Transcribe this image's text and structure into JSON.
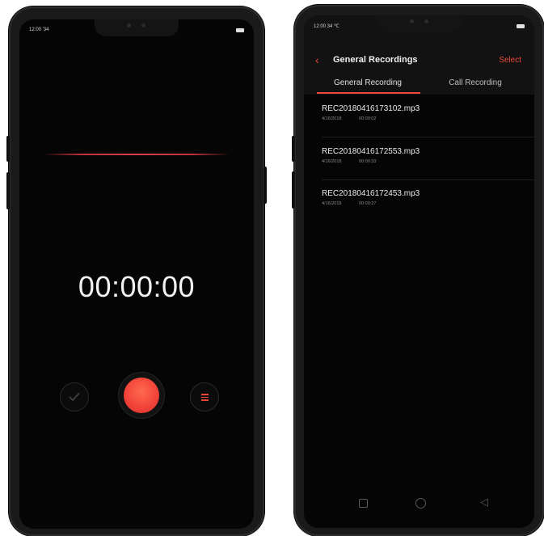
{
  "recorder_screen": {
    "status_time": "12:00 '34",
    "timer": "00:00:00"
  },
  "recordings_screen": {
    "status_time": "12:00 34 ℃",
    "title": "General Recordings",
    "select_label": "Select",
    "tabs": [
      {
        "label": "General Recording",
        "active": true
      },
      {
        "label": "Call Recording",
        "active": false
      }
    ],
    "recordings": [
      {
        "name": "REC20180416173102.mp3",
        "date": "4/16/2018",
        "duration": "00:00:02"
      },
      {
        "name": "REC20180416172553.mp3",
        "date": "4/16/2018",
        "duration": "00:00:33"
      },
      {
        "name": "REC20180416172453.mp3",
        "date": "4/16/2018",
        "duration": "00:00:27"
      }
    ]
  },
  "colors": {
    "accent": "#e8473a",
    "background": "#050505",
    "record_button": "#f2453a"
  },
  "icons": {
    "back": "chevron-left-icon",
    "confirm": "checkmark-icon",
    "list": "list-icon",
    "record": "record-icon",
    "nav_recents": "square-icon",
    "nav_home": "circle-icon",
    "nav_back": "triangle-back-icon"
  }
}
